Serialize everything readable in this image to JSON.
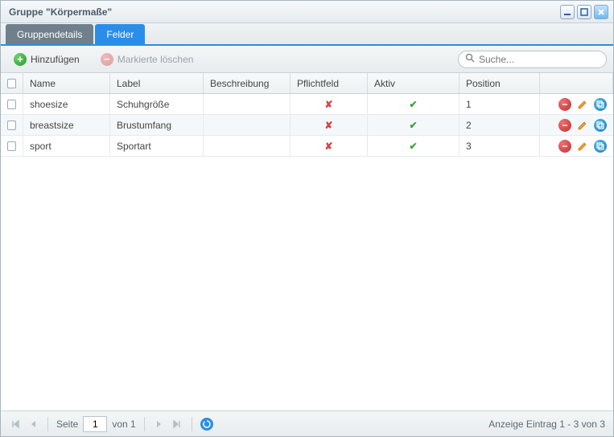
{
  "window": {
    "title": "Gruppe \"Körpermaße\""
  },
  "tabs": [
    {
      "label": "Gruppendetails",
      "active": false
    },
    {
      "label": "Felder",
      "active": true
    }
  ],
  "toolbar": {
    "add_label": "Hinzufügen",
    "delete_label": "Markierte löschen"
  },
  "search": {
    "placeholder": "Suche..."
  },
  "columns": {
    "name": "Name",
    "label": "Label",
    "beschreibung": "Beschreibung",
    "pflichtfeld": "Pflichtfeld",
    "aktiv": "Aktiv",
    "position": "Position"
  },
  "rows": [
    {
      "name": "shoesize",
      "label": "Schuhgröße",
      "beschreibung": "",
      "pflichtfeld": false,
      "aktiv": true,
      "position": "1"
    },
    {
      "name": "breastsize",
      "label": "Brustumfang",
      "beschreibung": "",
      "pflichtfeld": false,
      "aktiv": true,
      "position": "2"
    },
    {
      "name": "sport",
      "label": "Sportart",
      "beschreibung": "",
      "pflichtfeld": false,
      "aktiv": true,
      "position": "3"
    }
  ],
  "pager": {
    "page_label": "Seite",
    "page": "1",
    "of_label": "von 1",
    "status": "Anzeige Eintrag 1 - 3 von 3"
  }
}
